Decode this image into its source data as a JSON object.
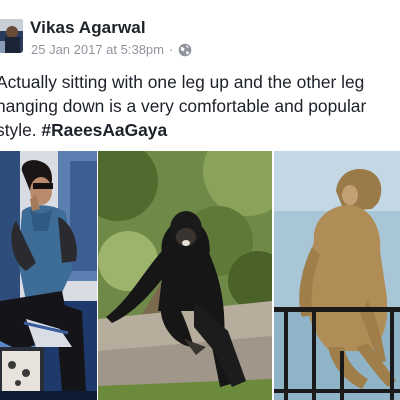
{
  "post": {
    "author": "Vikas Agarwal",
    "timestamp": "25 Jan 2017 at 5:38pm",
    "separator": "·",
    "privacy_icon": "globe-icon",
    "text_lines": [
      "Actually sitting with one leg up and the other leg",
      "hanging down is a very comfortable and popular"
    ],
    "text_last_prefix": "style. ",
    "hashtag": "#RaeesAaGaya",
    "photos": [
      {
        "subject": "man-seated-phone"
      },
      {
        "subject": "chimpanzee-seated"
      },
      {
        "subject": "monkey-seated-railing"
      }
    ]
  },
  "colors": {
    "text": "#1d2129",
    "meta": "#90949c",
    "background": "#ffffff"
  }
}
